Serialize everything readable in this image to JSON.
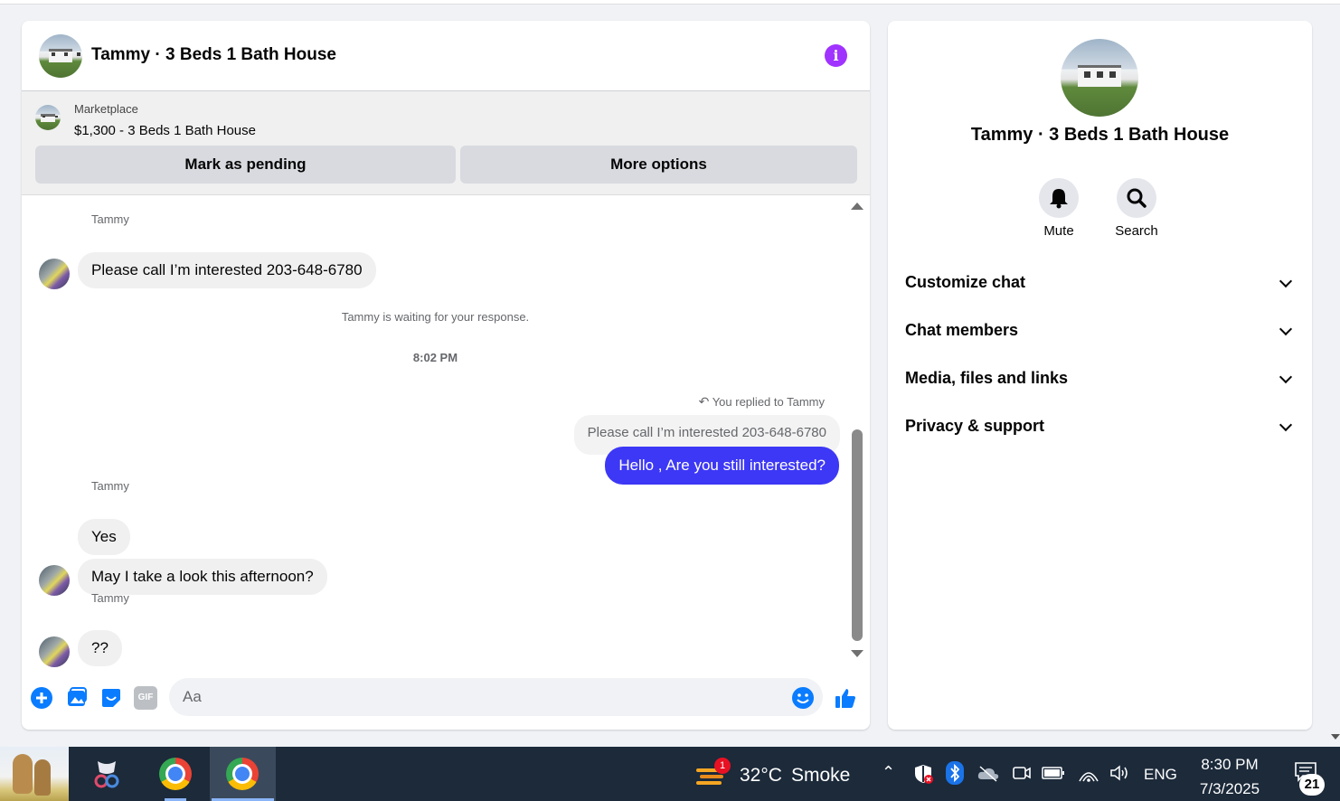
{
  "chat": {
    "header_title": "Tammy · 3 Beds 1 Bath House",
    "marketplace_label": "Marketplace",
    "listing_title": "$1,300 - 3 Beds 1 Bath House",
    "mark_pending_label": "Mark as pending",
    "more_options_label": "More options",
    "messages": {
      "sender1": "Tammy",
      "msg1": "Please call I’m interested 203-648-6780",
      "waiting_note": "Tammy is waiting for your response.",
      "timestamp": "8:02 PM",
      "replied_note": "You replied to Tammy",
      "quoted": "Please call I’m interested 203-648-6780",
      "outgoing": "Hello , Are you still interested?",
      "sender2": "Tammy",
      "msg2": "Yes",
      "msg3": "May I take a look this afternoon?",
      "sender3": "Tammy",
      "msg4": "??"
    },
    "composer_placeholder": "Aa",
    "icons": [
      "plus-icon",
      "photo-icon",
      "sticker-icon",
      "gif-icon",
      "emoji-icon",
      "thumbs-up-icon"
    ],
    "gif_label": "GIF"
  },
  "side": {
    "title": "Tammy · 3 Beds 1 Bath House",
    "mute_label": "Mute",
    "search_label": "Search",
    "sections": [
      "Customize chat",
      "Chat members",
      "Media, files and links",
      "Privacy & support"
    ]
  },
  "taskbar": {
    "weather_temp": "32°C",
    "weather_desc": "Smoke",
    "weather_badge": "1",
    "lang": "ENG",
    "time": "8:30 PM",
    "date": "7/3/2025",
    "notifications": "21"
  },
  "colors": {
    "accent_blue": "#3d38f5",
    "messenger_blue": "#0a7cff",
    "info_purple": "#a033ff"
  }
}
